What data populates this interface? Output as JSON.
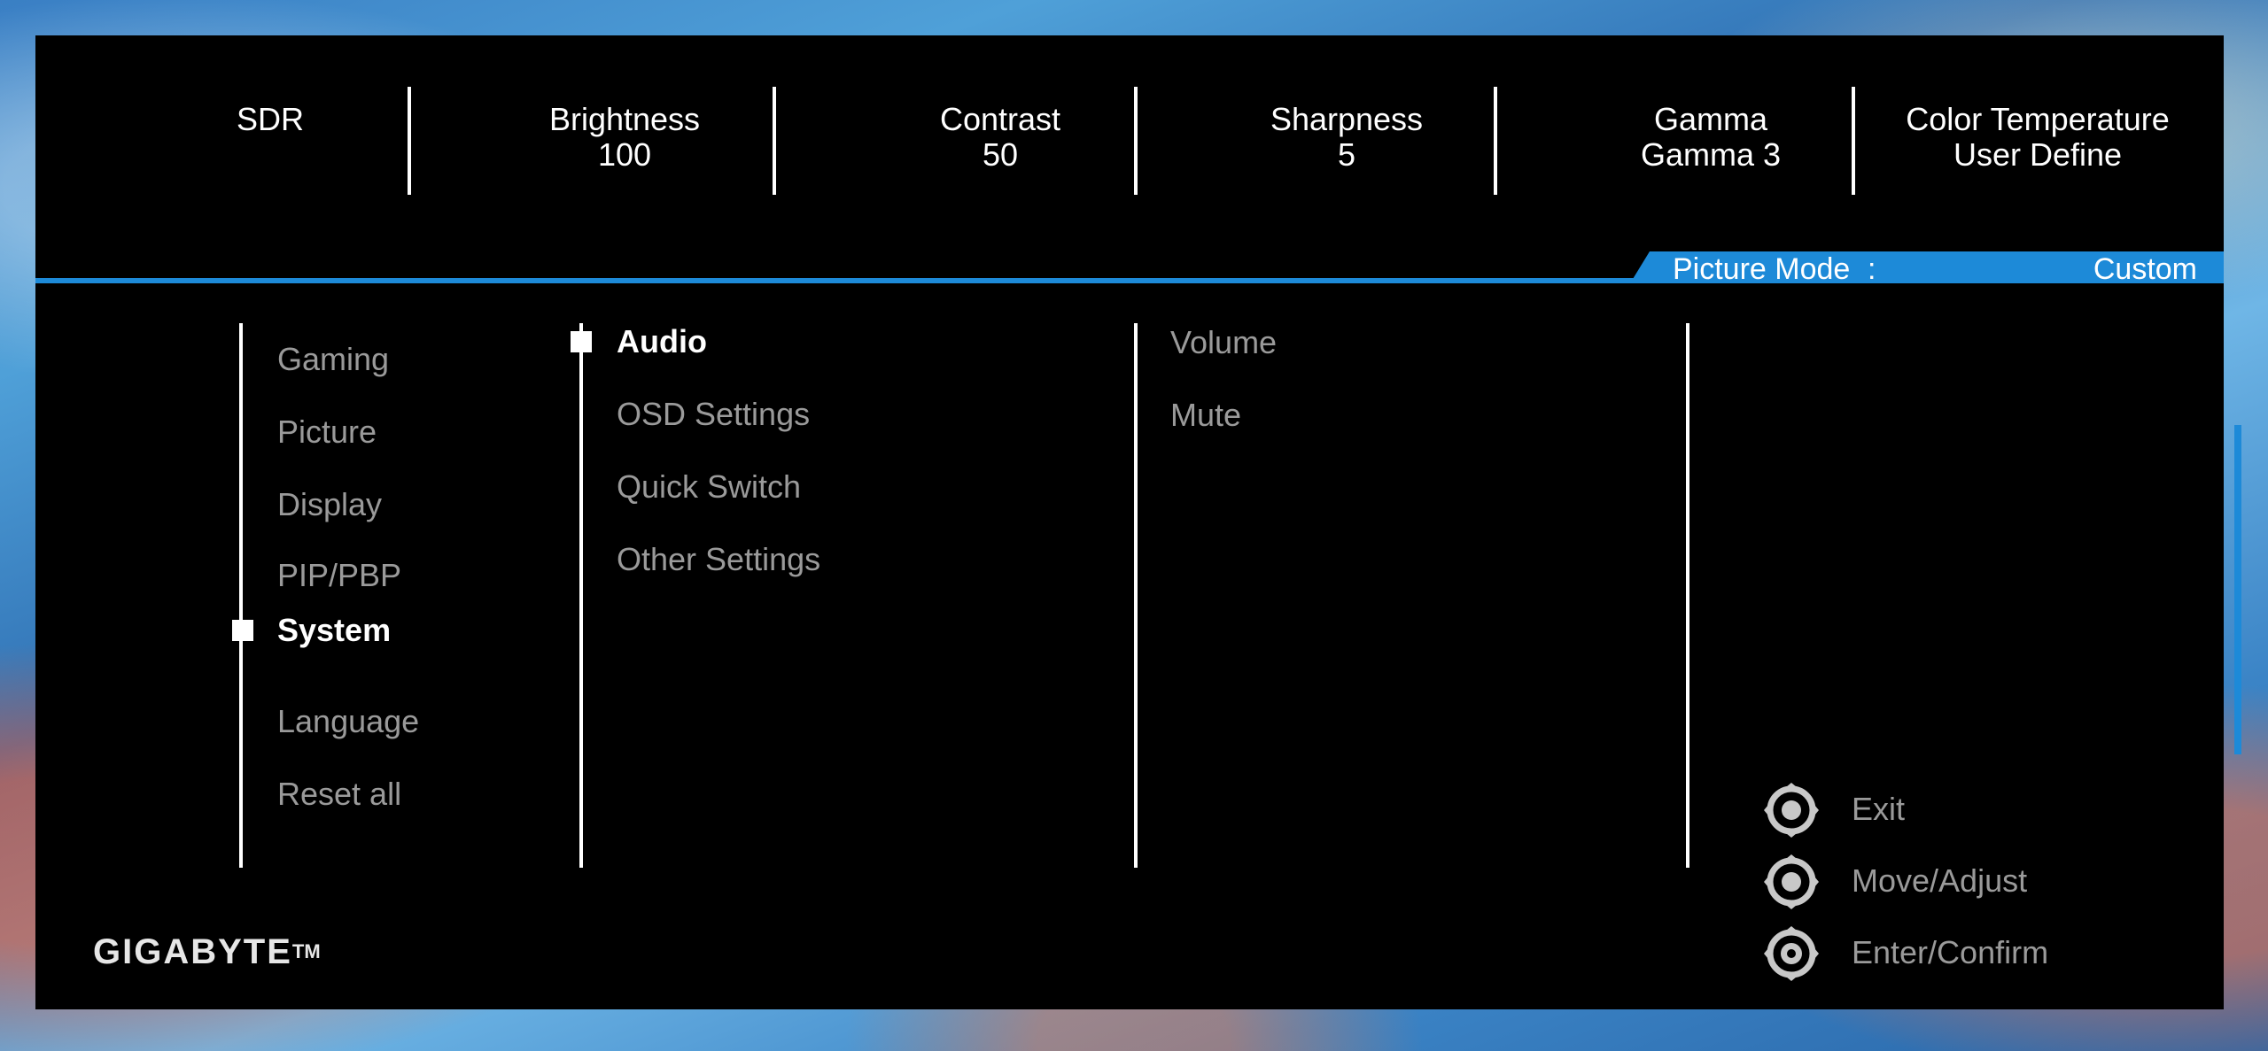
{
  "top_bar": {
    "items": [
      {
        "label": "SDR",
        "value": ""
      },
      {
        "label": "Brightness",
        "value": "100"
      },
      {
        "label": "Contrast",
        "value": "50"
      },
      {
        "label": "Sharpness",
        "value": "5"
      },
      {
        "label": "Gamma",
        "value": "Gamma 3"
      },
      {
        "label": "Color Temperature",
        "value": "User Define"
      }
    ]
  },
  "picture_mode": {
    "label": "Picture Mode",
    "colon": ":",
    "value": "Custom"
  },
  "main_menu": {
    "items": [
      "Gaming",
      "Picture",
      "Display",
      "PIP/PBP",
      "System",
      "Language",
      "Reset all"
    ],
    "selected": "System"
  },
  "sub_menu": {
    "items": [
      "Audio",
      "OSD Settings",
      "Quick Switch",
      "Other Settings"
    ],
    "selected": "Audio"
  },
  "detail_menu": {
    "items": [
      "Volume",
      "Mute"
    ]
  },
  "controls": [
    {
      "label": "Exit",
      "icon": "joystick-icon"
    },
    {
      "label": "Move/Adjust",
      "icon": "joystick-icon"
    },
    {
      "label": "Enter/Confirm",
      "icon": "joystick-press-icon"
    }
  ],
  "brand": {
    "name": "GIGABYTE",
    "tm": "TM"
  },
  "colors": {
    "accent": "#1d8ad8",
    "panel": "#000000",
    "text_active": "#ffffff",
    "text_inactive": "#9a9a9a"
  }
}
